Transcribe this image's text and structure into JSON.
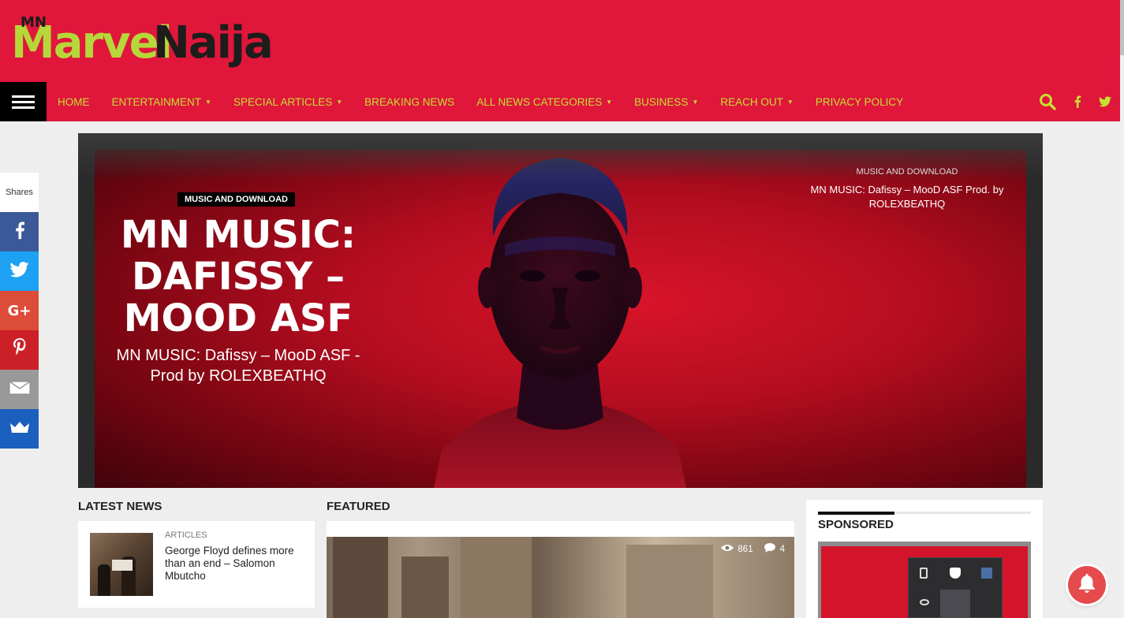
{
  "site": {
    "logo_mn": "MN",
    "logo_word1": "Marvel",
    "logo_word2": "Naija",
    "colors": {
      "brand": "#e0163b",
      "accent": "#c5e031",
      "dark": "#000000"
    }
  },
  "nav": {
    "menu_icon": "hamburger-icon",
    "items": [
      {
        "label": "HOME",
        "caret": false
      },
      {
        "label": "ENTERTAINMENT",
        "caret": true
      },
      {
        "label": "SPECIAL ARTICLES",
        "caret": true
      },
      {
        "label": "BREAKING NEWS",
        "caret": false
      },
      {
        "label": "ALL NEWS CATEGORIES",
        "caret": true
      },
      {
        "label": "BUSINESS",
        "caret": true
      },
      {
        "label": "REACH OUT",
        "caret": true
      },
      {
        "label": "PRIVACY POLICY",
        "caret": false
      }
    ],
    "icons": [
      "search-icon",
      "facebook-icon",
      "twitter-icon"
    ]
  },
  "share": {
    "label": "Shares",
    "buttons": [
      {
        "name": "facebook",
        "color": "#3b5998"
      },
      {
        "name": "twitter",
        "color": "#1da1f2"
      },
      {
        "name": "google-plus",
        "color": "#dd4b39"
      },
      {
        "name": "pinterest",
        "color": "#cb2027"
      },
      {
        "name": "email",
        "color": "#999999"
      },
      {
        "name": "sumo",
        "color": "#1b5fbf"
      }
    ]
  },
  "hero": {
    "category": "MUSIC AND DOWNLOAD",
    "title": "MN MUSIC: DAFISSY – MOOD ASF",
    "subtitle": "MN MUSIC: Dafissy – MooD ASF -Prod by ROLEXBEATHQ",
    "side_category": "MUSIC AND DOWNLOAD",
    "side_title": "MN MUSIC: Dafissy – MooD ASF Prod. by ROLEXBEATHQ"
  },
  "latest": {
    "heading": "LATEST NEWS",
    "article": {
      "category": "ARTICLES",
      "title": "George Floyd defines more than an end – Salomon Mbutcho"
    }
  },
  "featured": {
    "heading": "FEATURED",
    "views": "861",
    "comments": "4"
  },
  "sponsored": {
    "heading": "SPONSORED"
  }
}
